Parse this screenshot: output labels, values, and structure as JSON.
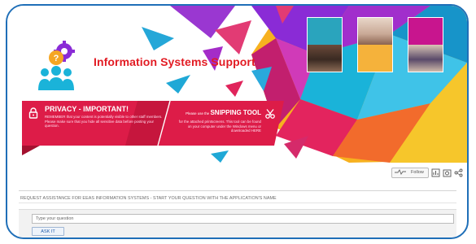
{
  "banner": {
    "title": "Information Systems Support",
    "privacy": {
      "title": "PRIVACY - IMPORTANT!",
      "text": "REMEMBER that your content is potentially visible to other staff members. Please make sure that you hide all sensitive data before posting your question."
    },
    "snipping": {
      "pre": "Please use the",
      "title": "SNIPPING TOOL",
      "text": "for the attached printscreens. This tool can be found on your computer under the Windows menu or downloaded HERE"
    },
    "icons": {
      "logo": "people-gear-question-icon",
      "lock": "lock-icon",
      "scissors": "scissors-icon"
    },
    "colors": {
      "title": "#e21b23",
      "red_bar": "#dd1c48"
    }
  },
  "toolbar": {
    "follow_label": "Follow",
    "icons": [
      "activity-icon",
      "reports-icon",
      "settings-icon",
      "share-icon"
    ]
  },
  "request": {
    "label": "REQUEST ASSISTANCE FOR EEAS INFORMATION SYSTEMS - START YOUR QUESTION WITH THE APPLICATION'S NAME",
    "placeholder": "Type your question",
    "ask_label": "ASK IT"
  }
}
